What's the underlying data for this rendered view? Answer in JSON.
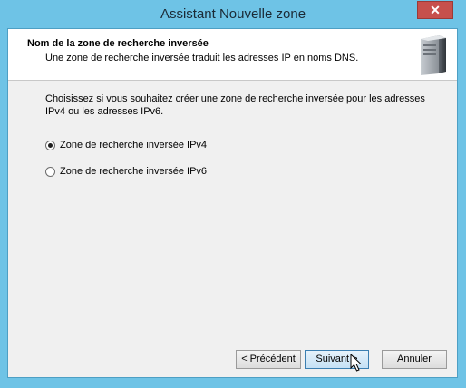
{
  "window": {
    "title": "Assistant Nouvelle zone",
    "close_label": "✕"
  },
  "header": {
    "title": "Nom de la zone de recherche inversée",
    "description": "Une zone de recherche inversée traduit les adresses IP en noms DNS.",
    "icon": "server-icon"
  },
  "body": {
    "instruction": "Choisissez si vous souhaitez créer une zone de recherche inversée pour les adresses IPv4 ou les adresses IPv6.",
    "options": [
      {
        "label": "Zone de recherche inversée IPv4",
        "checked": true
      },
      {
        "label": "Zone de recherche inversée IPv6",
        "checked": false
      }
    ]
  },
  "buttons": {
    "back": "< Précédent",
    "next": "Suivant >",
    "cancel": "Annuler"
  },
  "colors": {
    "titlebar": "#6ec3e6",
    "close": "#c7504c",
    "primary_border": "#3c7fb1"
  }
}
